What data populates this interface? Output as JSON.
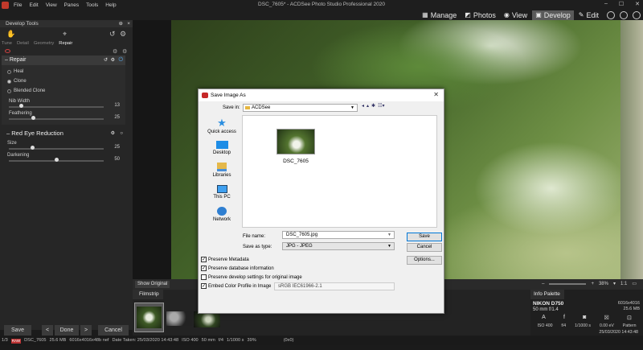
{
  "menu": [
    "File",
    "Edit",
    "View",
    "Panes",
    "Tools",
    "Help"
  ],
  "window_title": "DSC_7605* - ACDSee Photo Studio Professional 2020",
  "modes": [
    {
      "label": "Manage",
      "icon": "grid-icon"
    },
    {
      "label": "Photos",
      "icon": "photos-icon"
    },
    {
      "label": "View",
      "icon": "eye-icon"
    },
    {
      "label": "Develop",
      "icon": "develop-icon",
      "active": true
    },
    {
      "label": "Edit",
      "icon": "pencil-icon"
    }
  ],
  "left_panel": {
    "title": "Develop Tools",
    "tabs": [
      "Tune",
      "Detail",
      "Geometry",
      "Repair"
    ],
    "repair": {
      "title": "Repair",
      "options": [
        {
          "label": "Heal",
          "selected": false
        },
        {
          "label": "Clone",
          "selected": true
        },
        {
          "label": "Blended Clone",
          "selected": false
        }
      ],
      "sliders": [
        {
          "label": "Nib Width",
          "value": "13",
          "fraction": 0.13
        },
        {
          "label": "Feathering",
          "value": "25",
          "fraction": 0.25
        }
      ]
    },
    "red_eye": {
      "title": "Red Eye Reduction",
      "sliders": [
        {
          "label": "Size",
          "value": "25",
          "fraction": 0.25
        },
        {
          "label": "Darkening",
          "value": "50",
          "fraction": 0.5
        }
      ]
    },
    "buttons": {
      "save": "Save",
      "prev": "<",
      "done": "Done",
      "next": ">",
      "cancel": "Cancel"
    }
  },
  "viewbar": {
    "show_original": "Show Original",
    "zoom": "38%",
    "ratio": "1:1"
  },
  "filmstrip": {
    "title": "Filmstrip"
  },
  "info_palette": {
    "title": "Info Palette",
    "dimensions": "6016x4016",
    "size": "25.6 MB",
    "camera": "NIKON D750",
    "lens": "50 mm f/1.4",
    "icons": [
      "A",
      "f",
      "exposure-icon",
      "ev-icon",
      "metering-icon"
    ],
    "values": [
      "ISO 400",
      "f/4",
      "1/1000 s",
      "0.00 eV",
      "Pattern"
    ],
    "date": "25/03/2020 14:43:48"
  },
  "statusbar": {
    "count": "1/3",
    "badge": "RAW",
    "filename": "DSC_7605",
    "size": "25.6 MB",
    "dims": "6016x4016x48b nef",
    "date": "Date Taken: 25/03/2020 14:43:48",
    "iso": "ISO 400",
    "focal": "50 mm",
    "aperture": "f/4",
    "shutter": "1/1000 s",
    "zoom": "39%",
    "coords": "(0x0)"
  },
  "dialog": {
    "title": "Save Image As",
    "save_in_label": "Save in:",
    "save_in_value": "ACDSee",
    "places": [
      "Quick access",
      "Desktop",
      "Libraries",
      "This PC",
      "Network"
    ],
    "file": {
      "name": "DSC_7605"
    },
    "file_name_label": "File name:",
    "file_name_value": "DSC_7605.jpg",
    "save_type_label": "Save as type:",
    "save_type_value": "JPG - JPEG",
    "buttons": {
      "save": "Save",
      "cancel": "Cancel",
      "options": "Options..."
    },
    "checks": [
      {
        "label": "Preserve Metadata",
        "checked": true
      },
      {
        "label": "Preserve database information",
        "checked": true
      },
      {
        "label": "Preserve develop settings for original image",
        "checked": false
      },
      {
        "label": "Embed Color Profile in Image",
        "checked": true
      }
    ],
    "profile_value": "sRGB IEC61966-2.1"
  }
}
